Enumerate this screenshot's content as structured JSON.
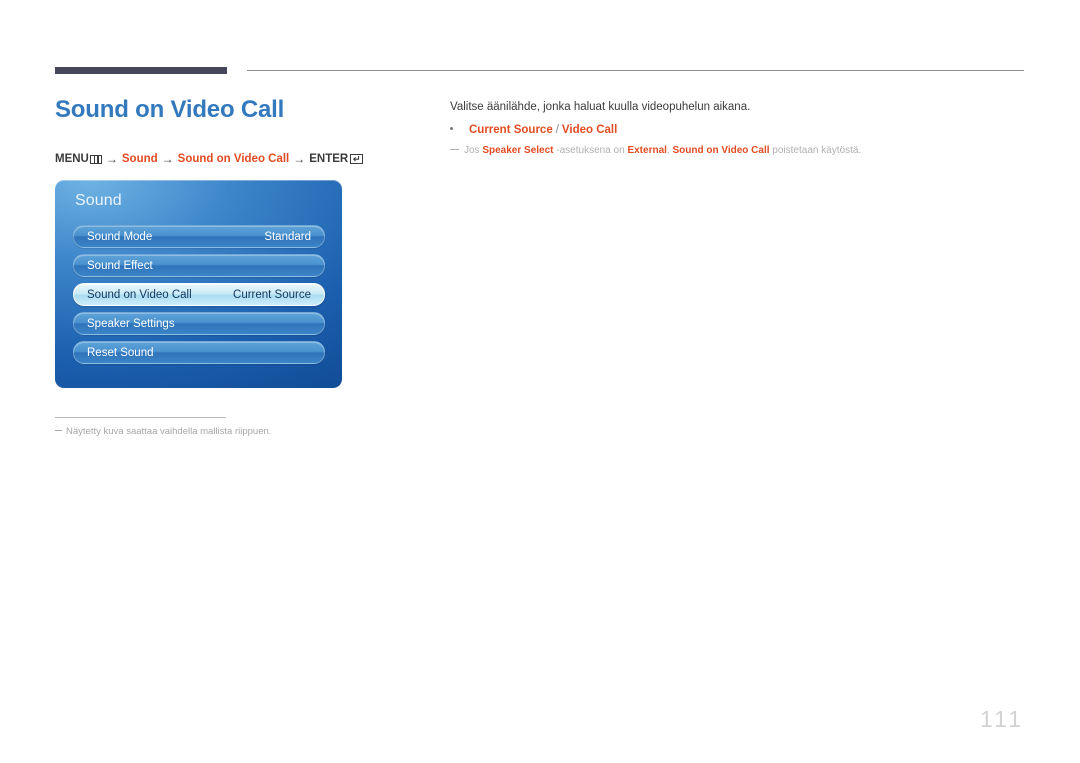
{
  "header": {
    "rule_dark": "decorative-dark-bar",
    "rule_thin": "decorative-thin-rule"
  },
  "page": {
    "title": "Sound on Video Call",
    "number": "111",
    "title_color": "#3379bd",
    "accent_color": "#e24c23"
  },
  "breadcrumb": {
    "menu_label": "MENU",
    "menu_icon": "menu-grid-icon",
    "arrow": "→",
    "step_sound": "Sound",
    "step_feature": "Sound on Video Call",
    "enter_label": "ENTER",
    "enter_icon": "enter-return-icon"
  },
  "osd": {
    "heading": "Sound",
    "rows": [
      {
        "label": "Sound Mode",
        "value": "Standard",
        "selected": false
      },
      {
        "label": "Sound Effect",
        "value": "",
        "selected": false
      },
      {
        "label": "Sound on Video Call",
        "value": "Current Source",
        "selected": true
      },
      {
        "label": "Speaker Settings",
        "value": "",
        "selected": false
      },
      {
        "label": "Reset Sound",
        "value": "",
        "selected": false
      }
    ]
  },
  "left_footnote": {
    "text": "Näytetty kuva saattaa vaihdella mallista riippuen."
  },
  "description": {
    "intro": "Valitse äänilähde, jonka haluat kuulla videopuhelun aikana.",
    "bullet": {
      "option_a": "Current Source",
      "separator": "/",
      "option_b": "Video Call"
    },
    "note": {
      "part1": "Jos ",
      "hl1": "Speaker Select",
      "part2": " -asetuksena on ",
      "hl2": "External",
      "part3": ", ",
      "hl3": "Sound on Video Call",
      "part4": " poistetaan käytöstä."
    }
  }
}
